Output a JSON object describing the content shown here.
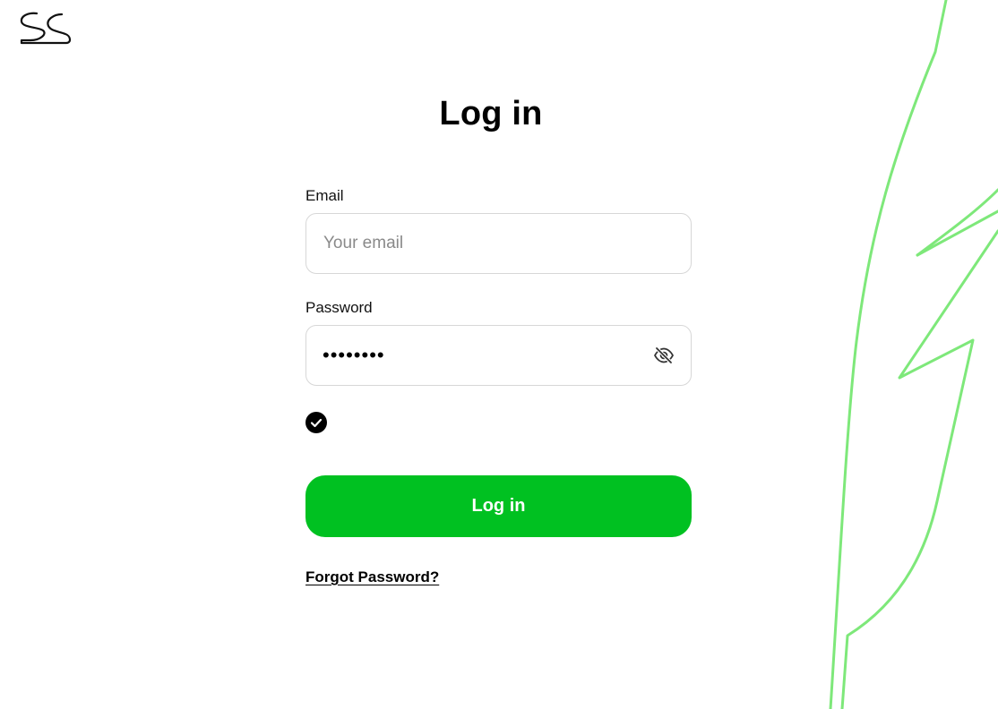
{
  "brand": {
    "logo_icon": "ss-logo-icon"
  },
  "page": {
    "title": "Log in"
  },
  "form": {
    "email": {
      "label": "Email",
      "placeholder": "Your email",
      "value": ""
    },
    "password": {
      "label": "Password",
      "masked_value": "••••••••",
      "visibility_icon": "eye-off-icon"
    },
    "checkbox": {
      "checked": true,
      "icon": "check-icon"
    },
    "submit_label": "Log in",
    "forgot_password_label": "Forgot Password?"
  },
  "colors": {
    "accent": "#00C121",
    "decoration": "#7EE87A",
    "text": "#000000",
    "placeholder": "#8A8A8A",
    "input_border": "#D7D7D7"
  }
}
